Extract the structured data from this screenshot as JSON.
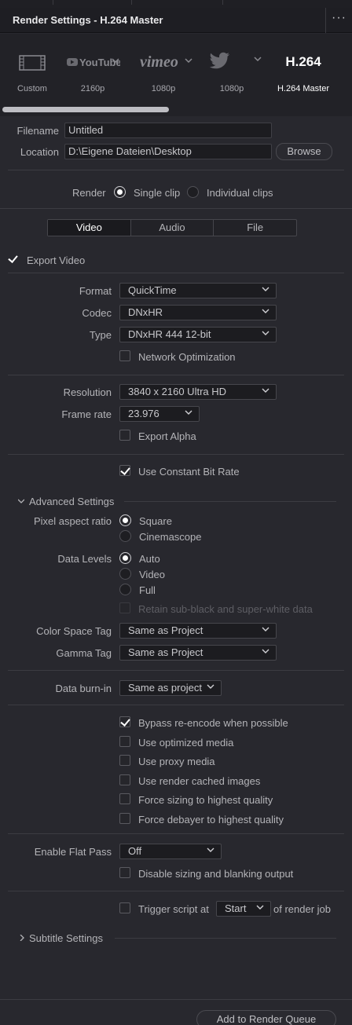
{
  "window": {
    "title": "Render Settings - H.264 Master",
    "more_label": "···"
  },
  "presets": [
    {
      "label": "Custom",
      "icon": "film-frame-icon"
    },
    {
      "label": "2160p",
      "icon": "youtube-logo",
      "logo_text": "YouTube"
    },
    {
      "label": "1080p",
      "icon": "vimeo-logo",
      "logo_text": "vimeo"
    },
    {
      "label": "1080p",
      "icon": "twitter-bird-icon"
    },
    {
      "label": "H.264 Master",
      "icon": "h264-logo",
      "logo_text": "H.264",
      "active": true
    }
  ],
  "file": {
    "filename_label": "Filename",
    "filename_value": "Untitled",
    "location_label": "Location",
    "location_value": "D:\\Eigene Dateien\\Desktop",
    "browse_label": "Browse"
  },
  "render": {
    "label": "Render",
    "single_clip": "Single clip",
    "individual_clips": "Individual clips",
    "selected": "single"
  },
  "tabs": [
    "Video",
    "Audio",
    "File"
  ],
  "video": {
    "export_video_label": "Export Video",
    "format_label": "Format",
    "format_value": "QuickTime",
    "codec_label": "Codec",
    "codec_value": "DNxHR",
    "type_label": "Type",
    "type_value": "DNxHR 444 12-bit",
    "network_opt_label": "Network Optimization",
    "resolution_label": "Resolution",
    "resolution_value": "3840 x 2160 Ultra HD",
    "frame_rate_label": "Frame rate",
    "frame_rate_value": "23.976",
    "export_alpha_label": "Export Alpha",
    "constant_bitrate_label": "Use Constant Bit Rate"
  },
  "advanced": {
    "title": "Advanced Settings",
    "pixel_aspect_label": "Pixel aspect ratio",
    "pixel_aspect_options": [
      "Square",
      "Cinemascope"
    ],
    "data_levels_label": "Data Levels",
    "data_levels_options": [
      "Auto",
      "Video",
      "Full"
    ],
    "retain_label": "Retain sub-black and super-white data",
    "color_space_label": "Color Space Tag",
    "color_space_value": "Same as Project",
    "gamma_label": "Gamma Tag",
    "gamma_value": "Same as Project",
    "burn_in_label": "Data burn-in",
    "burn_in_value": "Same as project",
    "bypass_label": "Bypass re-encode when possible",
    "optimized_label": "Use optimized media",
    "proxy_label": "Use proxy media",
    "cached_label": "Use render cached images",
    "force_sizing_label": "Force sizing to highest quality",
    "force_debayer_label": "Force debayer to highest quality",
    "flat_pass_label": "Enable Flat Pass",
    "flat_pass_value": "Off",
    "disable_sizing_label": "Disable sizing and blanking output",
    "trigger_label": "Trigger script at",
    "trigger_value": "Start",
    "trigger_suffix": "of render job"
  },
  "subtitle": {
    "title": "Subtitle Settings"
  },
  "footer": {
    "add_queue_label": "Add to Render Queue"
  }
}
